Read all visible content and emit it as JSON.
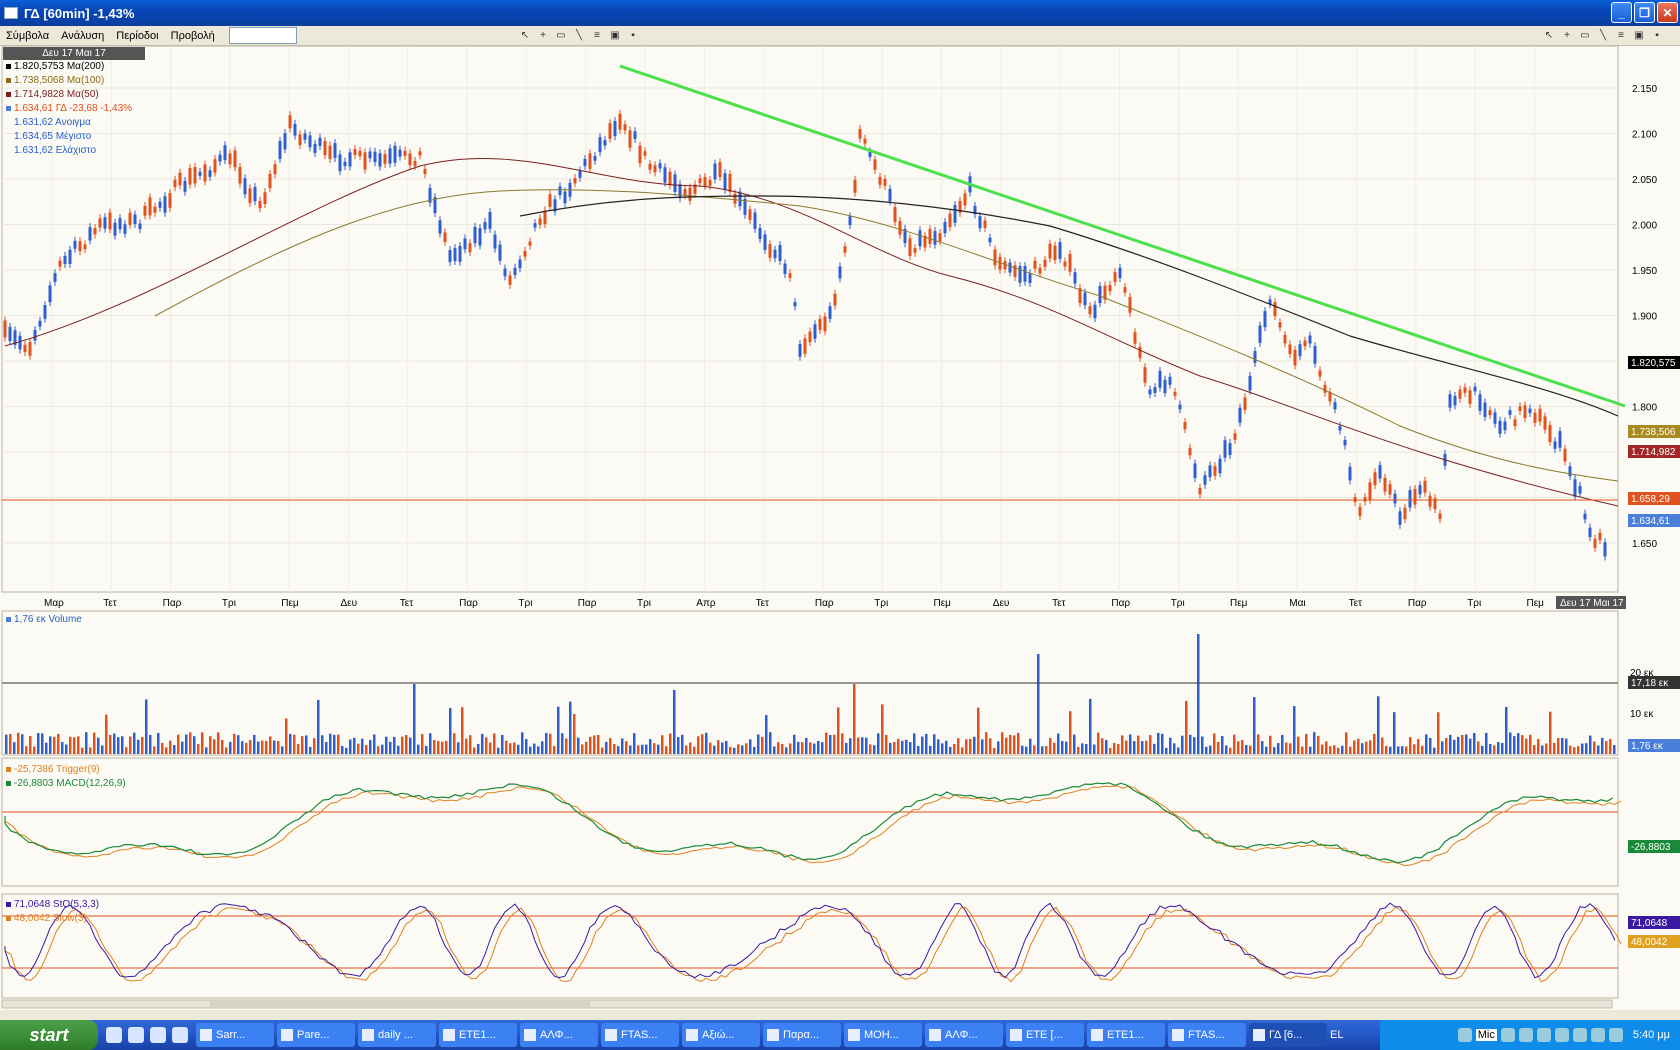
{
  "window": {
    "title": "ΓΔ [60min] -1,43%"
  },
  "menu": {
    "items": [
      "Σύμβολα",
      "Ανάλυση",
      "Περίοδοι",
      "Προβολή"
    ]
  },
  "price_panel": {
    "date": "Δευ 17 Μαι 17",
    "legend": [
      {
        "text": "1.820,5753 Mα(200)",
        "color": "#000000"
      },
      {
        "text": "1.738,5068 Mα(100)",
        "color": "#8a6a14"
      },
      {
        "text": "1.714,9828 Mα(50)",
        "color": "#7a1f1f"
      },
      {
        "text": "1.634,61 ΓΔ -23,68 -1,43%",
        "color": "#e0521e"
      },
      {
        "text": "1.631,62 Ανοιγμα",
        "color": "#2860c8"
      },
      {
        "text": "1.634,65 Μέγιστο",
        "color": "#2860c8"
      },
      {
        "text": "1.631,62 Ελάχιστο",
        "color": "#2860c8"
      }
    ],
    "y_ticks": [
      "2.150",
      "2.100",
      "2.050",
      "2.000",
      "1.950",
      "1.900",
      "1.850",
      "1.800",
      "1.750",
      "1.700",
      "1.650"
    ],
    "tags": [
      {
        "text": "1.820,575",
        "bg": "#000000"
      },
      {
        "text": "1.738,506",
        "bg": "#a88a20"
      },
      {
        "text": "1.714,982",
        "bg": "#a02828"
      },
      {
        "text": "1.658,29",
        "bg": "#e0521e"
      },
      {
        "text": "1.634,61",
        "bg": "#4a7ed8"
      }
    ],
    "x_labels": [
      "Μαρ",
      "Τετ",
      "Παρ",
      "Τρι",
      "Πεμ",
      "Δευ",
      "Τετ",
      "Παρ",
      "Τρι",
      "Παρ",
      "Τρι",
      "Απρ",
      "Τετ",
      "Παρ",
      "Τρι",
      "Πεμ",
      "Δευ",
      "Τετ",
      "Παρ",
      "Τρι",
      "Πεμ",
      "Μαι",
      "Τετ",
      "Παρ",
      "Τρι",
      "Πεμ"
    ],
    "x_last": "Δευ 17 Μαι 17"
  },
  "volume_panel": {
    "legend": "1,76 εκ Volume",
    "y_ticks": [
      "20 εκ",
      "10 εκ"
    ],
    "tags": [
      {
        "text": "17,18 εκ",
        "bg": "#333333"
      },
      {
        "text": "1,76 εκ",
        "bg": "#4a7ed8"
      }
    ]
  },
  "macd_panel": {
    "legend": [
      {
        "text": "-25,7386 Trigger(9)",
        "color": "#e0821e"
      },
      {
        "text": "-26,8803 MACD(12,26,9)",
        "color": "#1a8a3a"
      }
    ],
    "tag": {
      "text": "-26,8803",
      "bg": "#1a8a3a"
    }
  },
  "stoch_panel": {
    "legend": [
      {
        "text": "71,0648 StO(5,3,3)",
        "color": "#3a1aa0"
      },
      {
        "text": "48,0042 Slow(3)",
        "color": "#e0821e"
      }
    ],
    "tags": [
      {
        "text": "71,0648",
        "bg": "#3a1aa0"
      },
      {
        "text": "48,0042",
        "bg": "#e0a020"
      }
    ]
  },
  "taskbar": {
    "start": "start",
    "buttons": [
      "Sarr...",
      "Pare...",
      "daily ...",
      "ETE1...",
      "ΑΛΦ...",
      "FTAS...",
      "Αξιώ...",
      "Παρα...",
      "MOH...",
      "ΑΛΦ...",
      "ETE [...",
      "ETE1...",
      "FTAS...",
      "ΓΔ [6..."
    ],
    "lang": "EL",
    "tray_text": "Mic",
    "clock": "5:40 μμ"
  }
}
